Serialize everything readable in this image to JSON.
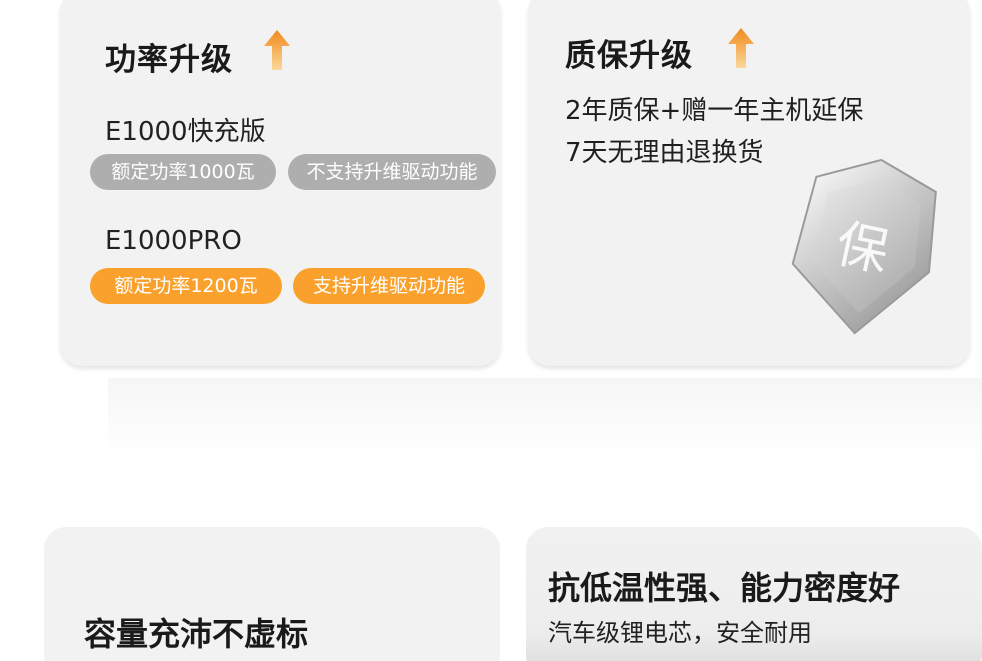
{
  "power_card": {
    "title": "功率升级",
    "models": [
      {
        "name": "E1000快充版",
        "tags": [
          "额定功率1000瓦",
          "不支持升维驱动功能"
        ]
      },
      {
        "name": "E1000PRO",
        "tags": [
          "额定功率1200瓦",
          "支持升维驱动功能"
        ]
      }
    ]
  },
  "warranty_card": {
    "title": "质保升级",
    "lines": [
      "2年质保+赠一年主机延保",
      "7天无理由退换货"
    ],
    "shield_text": "保"
  },
  "capacity_card": {
    "title": "容量充沛不虚标"
  },
  "cold_card": {
    "title": "抗低温性强、能力密度好",
    "subtitle": "汽车级锂电芯，安全耐用"
  },
  "colors": {
    "accent_orange": "#f9a12c",
    "tag_gray": "#aeaeae",
    "card_bg": "#f3f2f3"
  },
  "icons": {
    "upgrade": "arrow-up-icon",
    "warranty": "shield-icon"
  }
}
